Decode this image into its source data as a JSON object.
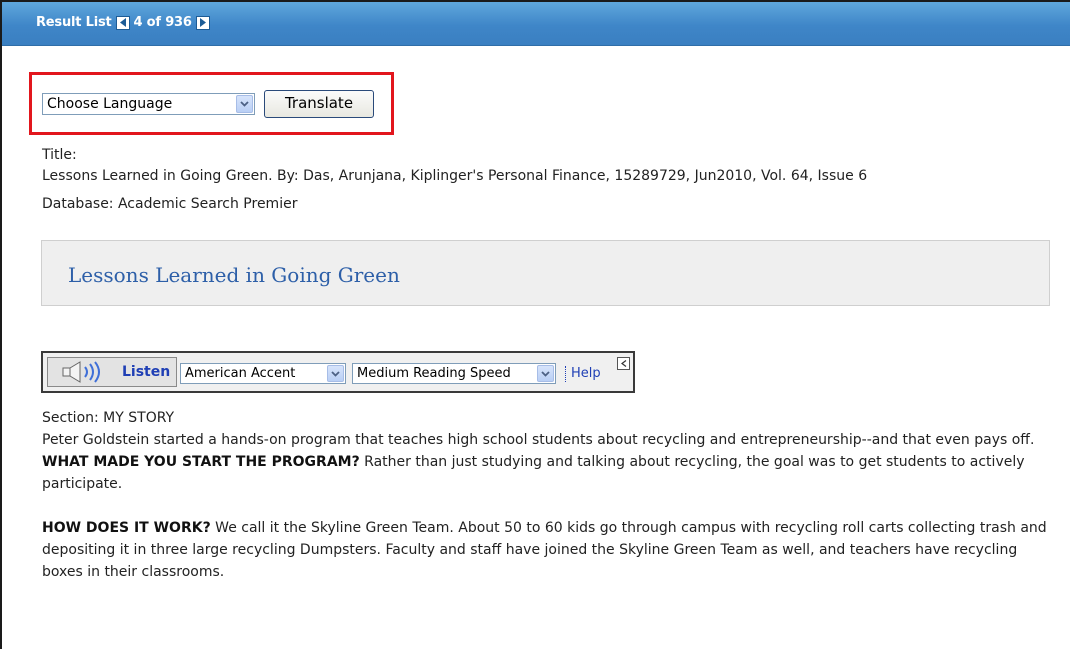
{
  "result_nav": {
    "label": "Result List",
    "position": "4 of 936"
  },
  "translate": {
    "select_value": "Choose Language",
    "button_label": "Translate"
  },
  "record": {
    "title_label": "Title:",
    "citation": "Lessons Learned in Going Green. By: Das, Arunjana, Kiplinger's Personal Finance, 15289729, Jun2010, Vol. 64, Issue 6",
    "database": "Database: Academic Search Premier"
  },
  "article_title": "Lessons Learned in Going Green",
  "listen_toolbar": {
    "listen_label": "Listen",
    "accent_value": "American Accent",
    "speed_value": "Medium Reading Speed",
    "help_label": "Help"
  },
  "article": {
    "section": "Section: MY STORY",
    "intro": "Peter Goldstein started a hands-on program that teaches high school students about recycling and entrepreneurship--and that even pays off.",
    "q1": "WHAT MADE YOU START THE PROGRAM?",
    "a1": " Rather than just studying and talking about recycling, the goal was to get students to actively participate.",
    "q2": "HOW DOES IT WORK?",
    "a2": " We call it the Skyline Green Team. About 50 to 60 kids go through campus with recycling roll carts collecting trash and depositing it in three large recycling Dumpsters. Faculty and staff have joined the Skyline Green Team as well, and teachers have recycling boxes in their classrooms."
  },
  "colors": {
    "header_blue": "#3f86c8",
    "highlight_red": "#e2161d",
    "title_blue": "#2d5fa8",
    "link_blue": "#1f3fb5"
  }
}
